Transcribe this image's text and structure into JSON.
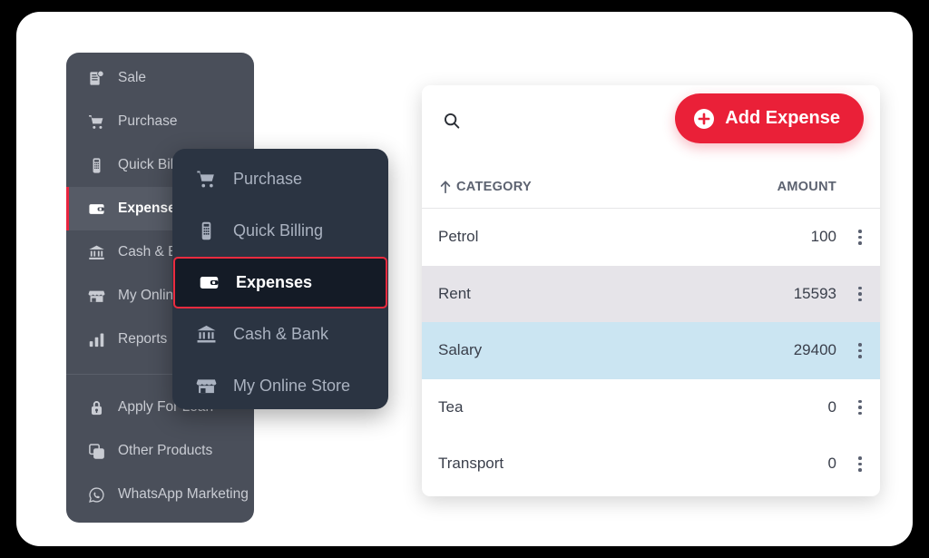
{
  "app": {
    "background_color": "#000000",
    "card_color": "#ffffff",
    "accent_color": "#ea2038",
    "sidebar_color": "#4a4f5a",
    "flyout_color": "#2b3442"
  },
  "sidebar": {
    "top_items": [
      {
        "label": "Sale",
        "icon": "invoice-icon",
        "active": false
      },
      {
        "label": "Purchase",
        "icon": "cart-icon",
        "active": false
      },
      {
        "label": "Quick Billing",
        "icon": "pos-terminal-icon",
        "active": false
      },
      {
        "label": "Expenses",
        "icon": "wallet-icon",
        "active": true
      },
      {
        "label": "Cash & Bank",
        "icon": "bank-icon",
        "active": false
      },
      {
        "label": "My Online Store",
        "icon": "store-icon",
        "active": false
      },
      {
        "label": "Reports",
        "icon": "bar-chart-icon",
        "active": false
      }
    ],
    "bottom_items": [
      {
        "label": "Apply For Loan",
        "icon": "lock-icon",
        "active": false
      },
      {
        "label": "Other Products",
        "icon": "copy-documents-icon",
        "active": false
      },
      {
        "label": "WhatsApp Marketing",
        "icon": "whatsapp-icon",
        "active": false
      }
    ]
  },
  "flyout": {
    "items": [
      {
        "label": "Purchase",
        "icon": "cart-icon",
        "active": false
      },
      {
        "label": "Quick Billing",
        "icon": "pos-terminal-icon",
        "active": false
      },
      {
        "label": "Expenses",
        "icon": "wallet-icon",
        "active": true
      },
      {
        "label": "Cash & Bank",
        "icon": "bank-icon",
        "active": false
      },
      {
        "label": "My Online Store",
        "icon": "store-icon",
        "active": false
      }
    ]
  },
  "content": {
    "toolbar": {
      "search_icon": "search-icon",
      "add_button_label": "Add Expense",
      "add_button_icon": "plus-circle-icon"
    },
    "table": {
      "columns": {
        "category": "CATEGORY",
        "amount": "AMOUNT",
        "sort_icon": "sort-ascending-arrow-icon"
      },
      "rows": [
        {
          "category": "Petrol",
          "amount": "100",
          "style": "plain"
        },
        {
          "category": "Rent",
          "amount": "15593",
          "style": "alt"
        },
        {
          "category": "Salary",
          "amount": "29400",
          "style": "selected"
        },
        {
          "category": "Tea",
          "amount": "0",
          "style": "plain"
        },
        {
          "category": "Transport",
          "amount": "0",
          "style": "plain"
        }
      ],
      "row_menu_icon": "vertical-dots-icon"
    }
  }
}
